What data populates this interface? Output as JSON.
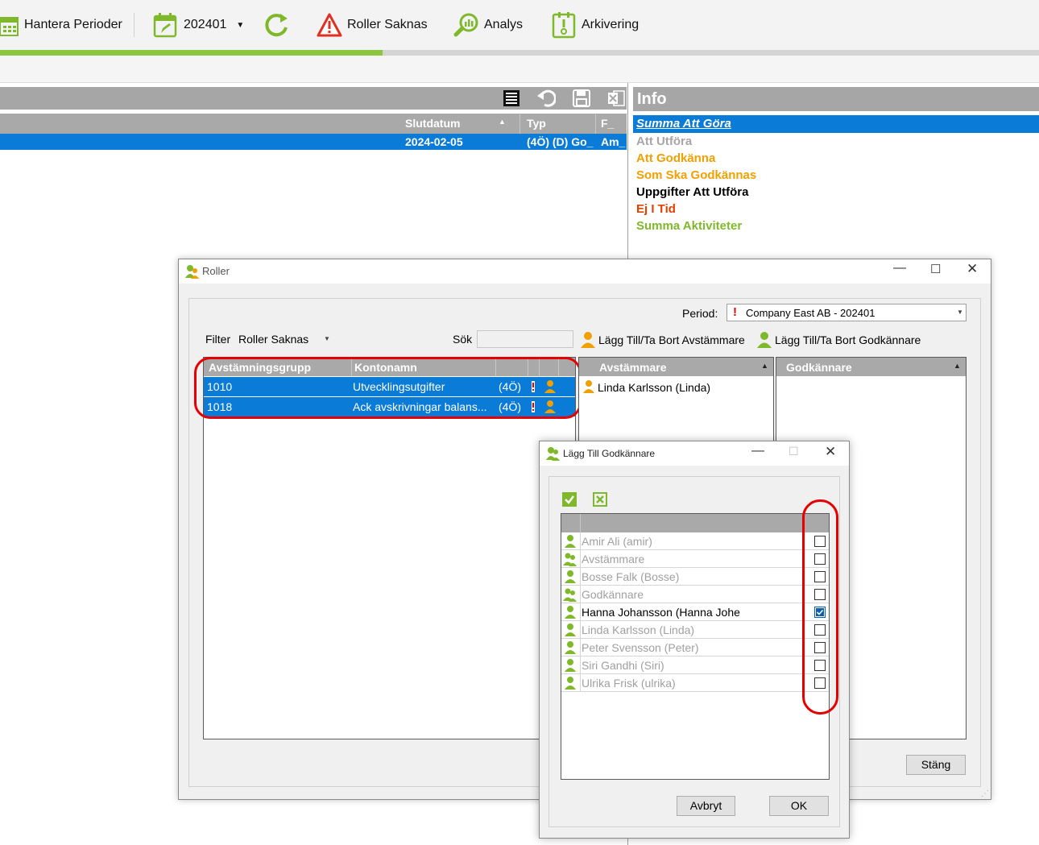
{
  "toolbar": {
    "hantera_perioder": "Hantera Perioder",
    "period_value": "202401",
    "roller_saknas": "Roller Saknas",
    "analys": "Analys",
    "arkivering": "Arkivering",
    "progress": 0.368
  },
  "left_grid": {
    "columns": [
      "Slutdatum",
      "Typ",
      "F_"
    ],
    "row": {
      "slutdatum": "2024-02-05",
      "typ": "(4Ö) (D) Go_",
      "f": "Am_"
    }
  },
  "info": {
    "title": "Info",
    "items": [
      {
        "label": "Summa Att Göra",
        "color": "#ffffff"
      },
      {
        "label": "Att Utföra",
        "color": "#a6a6a6"
      },
      {
        "label": "Att Godkänna",
        "color": "#f0a000"
      },
      {
        "label": "Som Ska Godkännas",
        "color": "#f0a000"
      },
      {
        "label": "Uppgifter Att Utföra",
        "color": "#000000"
      },
      {
        "label": "Ej I Tid",
        "color": "#e04000"
      },
      {
        "label": "Summa Aktiviteter",
        "color": "#7fb82a"
      }
    ]
  },
  "roller": {
    "title": "Roller",
    "period_label": "Period:",
    "period_value": "Company East AB - 202401",
    "filter_label": "Filter",
    "filter_value": "Roller Saknas",
    "search_label": "Sök",
    "search_value": "",
    "add_reconciler": "Lägg Till/Ta Bort Avstämmare",
    "add_approver": "Lägg Till/Ta Bort Godkännare",
    "groups_header": {
      "col1": "Avstämningsgrupp",
      "col2": "Kontonamn"
    },
    "groups": [
      {
        "group": "1010",
        "account": "Utvecklingsutgifter",
        "code": "(4Ö)"
      },
      {
        "group": "1018",
        "account": "Ack avskrivningar balans...",
        "code": "(4Ö)"
      }
    ],
    "reconcilers_header": "Avstämmare",
    "reconcilers": [
      "Linda Karlsson (Linda)"
    ],
    "approvers_header": "Godkännare",
    "close_button": "Stäng"
  },
  "dialog": {
    "title": "Lägg Till Godkännare",
    "users": [
      {
        "name": "Amir Ali (amir)",
        "type": "user",
        "checked": false,
        "active": false
      },
      {
        "name": "Avstämmare",
        "type": "group",
        "checked": false,
        "active": false
      },
      {
        "name": "Bosse Falk (Bosse)",
        "type": "user",
        "checked": false,
        "active": false
      },
      {
        "name": "Godkännare",
        "type": "group",
        "checked": false,
        "active": false
      },
      {
        "name": "Hanna Johansson (Hanna Johe",
        "type": "user",
        "checked": true,
        "active": true
      },
      {
        "name": "Linda Karlsson (Linda)",
        "type": "user",
        "checked": false,
        "active": false
      },
      {
        "name": "Peter Svensson (Peter)",
        "type": "user",
        "checked": false,
        "active": false
      },
      {
        "name": "Siri Gandhi (Siri)",
        "type": "user",
        "checked": false,
        "active": false
      },
      {
        "name": "Ulrika Frisk (ulrika)",
        "type": "user",
        "checked": false,
        "active": false
      }
    ],
    "cancel_button": "Avbryt",
    "ok_button": "OK"
  }
}
